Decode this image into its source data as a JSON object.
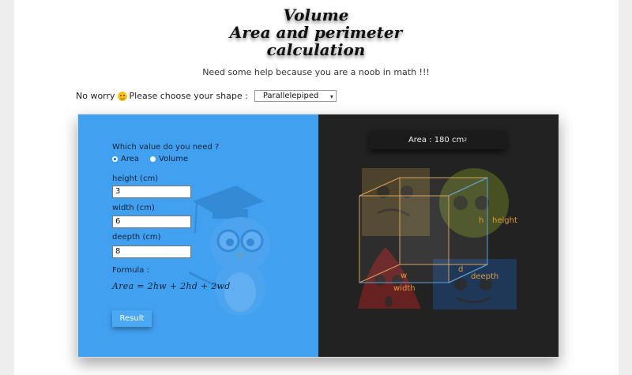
{
  "header": {
    "title_line1": "Volume",
    "title_line2": "Area and perimeter",
    "title_line3": "calculation",
    "subtitle": "Need some help because you are a noob in math !!!"
  },
  "shape_chooser": {
    "prefix": "No worry",
    "label": "Please choose your shape :",
    "selected": "Parallelepiped"
  },
  "form": {
    "question": "Which value do you need ?",
    "options": [
      {
        "label": "Area",
        "checked": true
      },
      {
        "label": "Volume",
        "checked": false
      }
    ],
    "height_label": "height (cm)",
    "height_value": "3",
    "width_label": "width (cm)",
    "width_value": "6",
    "deepth_label": "deepth (cm)",
    "deepth_value": "8",
    "formula_label": "Formula :",
    "formula": "Area =  2hw +  2hd +  2wd",
    "result_label": "Result"
  },
  "result": {
    "text": "Area : 180 cm",
    "unit_power": "2"
  },
  "diagram": {
    "h": "h",
    "height": "height",
    "w": "w",
    "width": "width",
    "d": "d",
    "deepth": "deepth"
  },
  "colors": {
    "left_panel": "#42a0f0",
    "right_panel": "#222222",
    "dimension_text": "#e09a3e"
  }
}
